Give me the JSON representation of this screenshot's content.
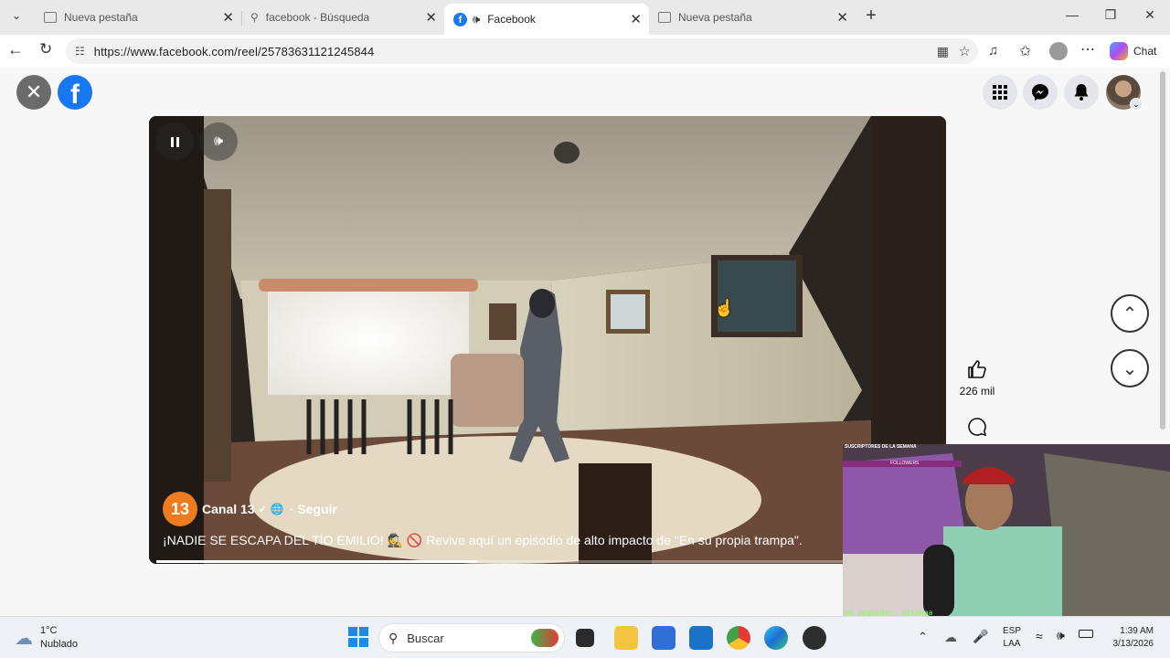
{
  "browser": {
    "tabs": [
      {
        "label": "Nueva pestaña",
        "icon": "page-icon"
      },
      {
        "label": "facebook - Búsqueda",
        "icon": "search-icon"
      },
      {
        "label": "Facebook",
        "icon": "facebook-icon",
        "active": true
      },
      {
        "label": "Nueva pestaña",
        "icon": "page-icon"
      }
    ],
    "url": "https://www.facebook.com/reel/25783631121245844",
    "chat_label": "Chat"
  },
  "reel": {
    "channel_badge": "13",
    "channel_name": "Canal 13",
    "follow_label": "· Seguir",
    "caption_start": "¡NADIE SE ESCAPA DEL TÍO EMILIO! ",
    "caption_end": " Revive aquí un episodio de alto impacto de \"En su propia trampa\".",
    "progress": 0.41,
    "likes": "226 mil"
  },
  "webcam": {
    "overlay_title": "SUSCRIPTORES DE LA SEMANA",
    "followers_label": "FOLLOWERS",
    "ticker": "mo seguidor: ditukaa"
  },
  "taskbar": {
    "weather_temp": "1°C",
    "weather_desc": "Nublado",
    "search_placeholder": "Buscar",
    "lang_top": "ESP",
    "lang_bottom": "LAA",
    "time": "1:39 AM",
    "date": "3/13/2026"
  },
  "colors": {
    "facebook_blue": "#1877f2",
    "channel_orange": "#ee7b1d"
  }
}
